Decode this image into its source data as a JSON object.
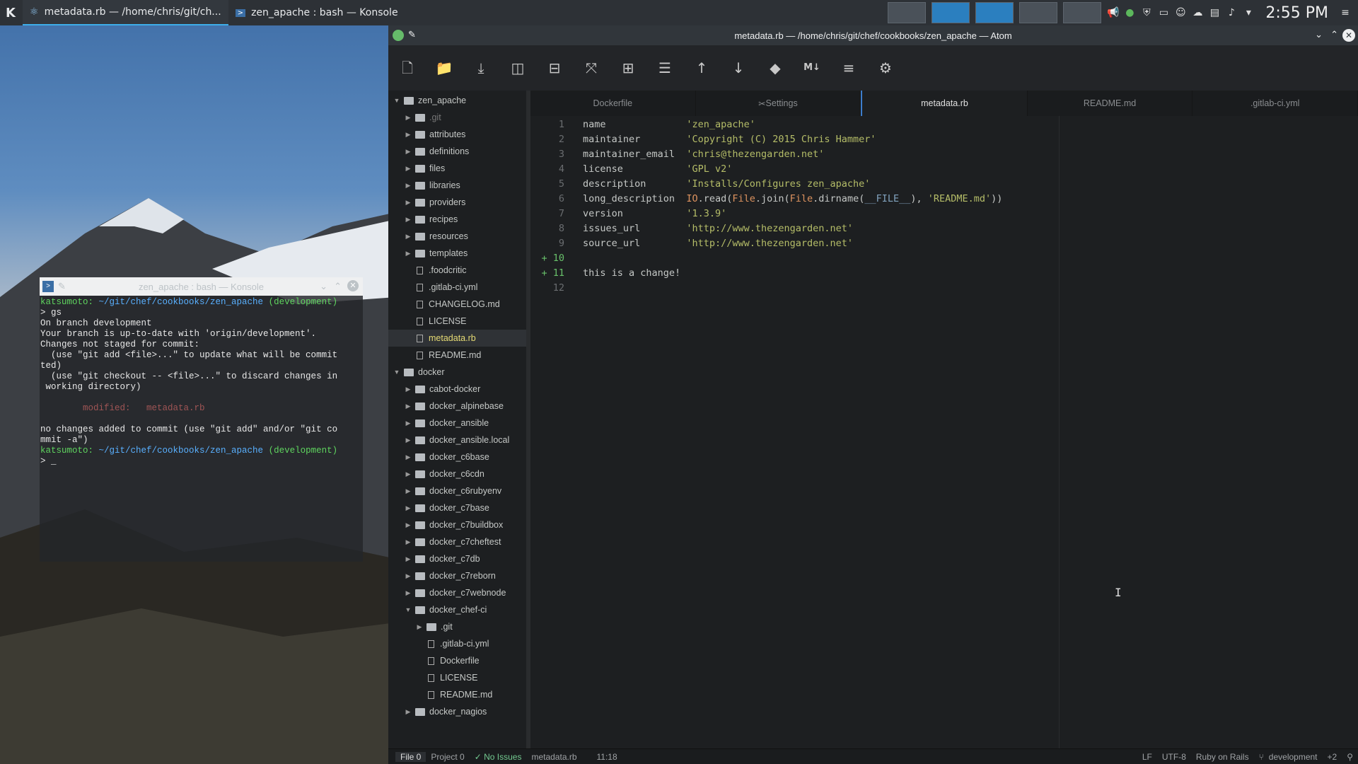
{
  "taskbar": {
    "tasks": [
      {
        "label": "metadata.rb — /home/chris/git/ch..."
      },
      {
        "label": "zen_apache : bash — Konsole"
      }
    ],
    "clock": "2:55 PM"
  },
  "konsole": {
    "title": "zen_apache : bash — Konsole",
    "lines": [
      {
        "parts": [
          {
            "t": "katsumoto: ",
            "c": "k-green"
          },
          {
            "t": "~/git/chef/cookbooks/zen_apache",
            "c": "k-blue"
          },
          {
            "t": " (development)",
            "c": "k-green"
          }
        ]
      },
      {
        "parts": [
          {
            "t": "> gs",
            "c": ""
          }
        ]
      },
      {
        "parts": [
          {
            "t": "On branch development",
            "c": ""
          }
        ]
      },
      {
        "parts": [
          {
            "t": "Your branch is up-to-date with 'origin/development'.",
            "c": ""
          }
        ]
      },
      {
        "parts": [
          {
            "t": "Changes not staged for commit:",
            "c": ""
          }
        ]
      },
      {
        "parts": [
          {
            "t": "  (use \"git add <file>...\" to update what will be commit",
            "c": ""
          }
        ]
      },
      {
        "parts": [
          {
            "t": "ted)",
            "c": ""
          }
        ]
      },
      {
        "parts": [
          {
            "t": "  (use \"git checkout -- <file>...\" to discard changes in",
            "c": ""
          }
        ]
      },
      {
        "parts": [
          {
            "t": " working directory)",
            "c": ""
          }
        ]
      },
      {
        "parts": [
          {
            "t": "",
            "c": ""
          }
        ]
      },
      {
        "parts": [
          {
            "t": "        modified:   metadata.rb",
            "c": "k-red"
          }
        ]
      },
      {
        "parts": [
          {
            "t": "",
            "c": ""
          }
        ]
      },
      {
        "parts": [
          {
            "t": "no changes added to commit (use \"git add\" and/or \"git co",
            "c": ""
          }
        ]
      },
      {
        "parts": [
          {
            "t": "mmit -a\")",
            "c": ""
          }
        ]
      },
      {
        "parts": [
          {
            "t": "katsumoto: ",
            "c": "k-green"
          },
          {
            "t": "~/git/chef/cookbooks/zen_apache",
            "c": "k-blue"
          },
          {
            "t": " (development)",
            "c": "k-green"
          }
        ]
      },
      {
        "parts": [
          {
            "t": "> _",
            "c": ""
          }
        ]
      }
    ]
  },
  "atom": {
    "title": "metadata.rb — /home/chris/git/chef/cookbooks/zen_apache — Atom",
    "tree": [
      {
        "label": "zen_apache",
        "kind": "root",
        "open": true,
        "level": 0
      },
      {
        "label": ".git",
        "kind": "folder",
        "level": 1,
        "dim": true
      },
      {
        "label": "attributes",
        "kind": "folder",
        "level": 1
      },
      {
        "label": "definitions",
        "kind": "folder",
        "level": 1
      },
      {
        "label": "files",
        "kind": "folder",
        "level": 1
      },
      {
        "label": "libraries",
        "kind": "folder",
        "level": 1
      },
      {
        "label": "providers",
        "kind": "folder",
        "level": 1
      },
      {
        "label": "recipes",
        "kind": "folder",
        "level": 1
      },
      {
        "label": "resources",
        "kind": "folder",
        "level": 1
      },
      {
        "label": "templates",
        "kind": "folder",
        "level": 1
      },
      {
        "label": ".foodcritic",
        "kind": "file",
        "level": 1
      },
      {
        "label": ".gitlab-ci.yml",
        "kind": "file",
        "level": 1
      },
      {
        "label": "CHANGELOG.md",
        "kind": "file",
        "level": 1
      },
      {
        "label": "LICENSE",
        "kind": "file",
        "level": 1
      },
      {
        "label": "metadata.rb",
        "kind": "file",
        "level": 1,
        "sel": true
      },
      {
        "label": "README.md",
        "kind": "file",
        "level": 1
      },
      {
        "label": "docker",
        "kind": "root",
        "open": true,
        "level": 0
      },
      {
        "label": "cabot-docker",
        "kind": "folder",
        "level": 1
      },
      {
        "label": "docker_alpinebase",
        "kind": "folder",
        "level": 1
      },
      {
        "label": "docker_ansible",
        "kind": "folder",
        "level": 1
      },
      {
        "label": "docker_ansible.local",
        "kind": "folder",
        "level": 1
      },
      {
        "label": "docker_c6base",
        "kind": "folder",
        "level": 1
      },
      {
        "label": "docker_c6cdn",
        "kind": "folder",
        "level": 1
      },
      {
        "label": "docker_c6rubyenv",
        "kind": "folder",
        "level": 1
      },
      {
        "label": "docker_c7base",
        "kind": "folder",
        "level": 1
      },
      {
        "label": "docker_c7buildbox",
        "kind": "folder",
        "level": 1
      },
      {
        "label": "docker_c7cheftest",
        "kind": "folder",
        "level": 1
      },
      {
        "label": "docker_c7db",
        "kind": "folder",
        "level": 1
      },
      {
        "label": "docker_c7reborn",
        "kind": "folder",
        "level": 1
      },
      {
        "label": "docker_c7webnode",
        "kind": "folder",
        "level": 1
      },
      {
        "label": "docker_chef-ci",
        "kind": "folder",
        "level": 1,
        "open": true
      },
      {
        "label": ".git",
        "kind": "folder",
        "level": 2
      },
      {
        "label": ".gitlab-ci.yml",
        "kind": "file",
        "level": 2
      },
      {
        "label": "Dockerfile",
        "kind": "file",
        "level": 2
      },
      {
        "label": "LICENSE",
        "kind": "file",
        "level": 2
      },
      {
        "label": "README.md",
        "kind": "file",
        "level": 2
      },
      {
        "label": "docker_nagios",
        "kind": "folder",
        "level": 1
      }
    ],
    "tabs": [
      {
        "label": "Dockerfile"
      },
      {
        "label": "Settings"
      },
      {
        "label": "metadata.rb",
        "active": true
      },
      {
        "label": "README.md"
      },
      {
        "label": ".gitlab-ci.yml"
      }
    ],
    "code": [
      {
        "n": "1",
        "parts": [
          {
            "t": "name              ",
            "c": "code"
          },
          {
            "t": "'zen_apache'",
            "c": "str"
          }
        ]
      },
      {
        "n": "2",
        "parts": [
          {
            "t": "maintainer        ",
            "c": "code"
          },
          {
            "t": "'Copyright (C) 2015 Chris Hammer'",
            "c": "str"
          }
        ]
      },
      {
        "n": "3",
        "parts": [
          {
            "t": "maintainer_email  ",
            "c": "code"
          },
          {
            "t": "'chris@thezengarden.net'",
            "c": "str"
          }
        ]
      },
      {
        "n": "4",
        "parts": [
          {
            "t": "license           ",
            "c": "code"
          },
          {
            "t": "'GPL v2'",
            "c": "str"
          }
        ]
      },
      {
        "n": "5",
        "parts": [
          {
            "t": "description       ",
            "c": "code"
          },
          {
            "t": "'Installs/Configures zen_apache'",
            "c": "str"
          }
        ]
      },
      {
        "n": "6",
        "parts": [
          {
            "t": "long_description  ",
            "c": "code"
          },
          {
            "t": "IO",
            "c": "cls"
          },
          {
            "t": ".read(",
            "c": "code"
          },
          {
            "t": "File",
            "c": "cls"
          },
          {
            "t": ".join(",
            "c": "code"
          },
          {
            "t": "File",
            "c": "cls"
          },
          {
            "t": ".dirname(",
            "c": "code"
          },
          {
            "t": "__FILE__",
            "c": "const"
          },
          {
            "t": "), ",
            "c": "code"
          },
          {
            "t": "'README.md'",
            "c": "str"
          },
          {
            "t": "))",
            "c": "code"
          }
        ]
      },
      {
        "n": "7",
        "parts": [
          {
            "t": "version           ",
            "c": "code"
          },
          {
            "t": "'1.3.9'",
            "c": "str"
          }
        ]
      },
      {
        "n": "8",
        "parts": [
          {
            "t": "issues_url        ",
            "c": "code"
          },
          {
            "t": "'http://www.thezengarden.net'",
            "c": "str"
          }
        ]
      },
      {
        "n": "9",
        "parts": [
          {
            "t": "source_url        ",
            "c": "code"
          },
          {
            "t": "'http://www.thezengarden.net'",
            "c": "str"
          }
        ]
      },
      {
        "n": "+ 10",
        "added": true,
        "parts": [
          {
            "t": "",
            "c": "code"
          }
        ]
      },
      {
        "n": "+ 11",
        "added": true,
        "parts": [
          {
            "t": "this is a change!",
            "c": "code"
          }
        ]
      },
      {
        "n": "12",
        "parts": [
          {
            "t": "",
            "c": "code"
          }
        ]
      }
    ],
    "status": {
      "file": "File 0",
      "project": "Project 0",
      "issues": "✓ No Issues",
      "filename": "metadata.rb",
      "cursor": "11:18",
      "eol": "LF",
      "encoding": "UTF-8",
      "grammar": "Ruby on Rails",
      "branch": "development",
      "changes": "+2"
    }
  }
}
